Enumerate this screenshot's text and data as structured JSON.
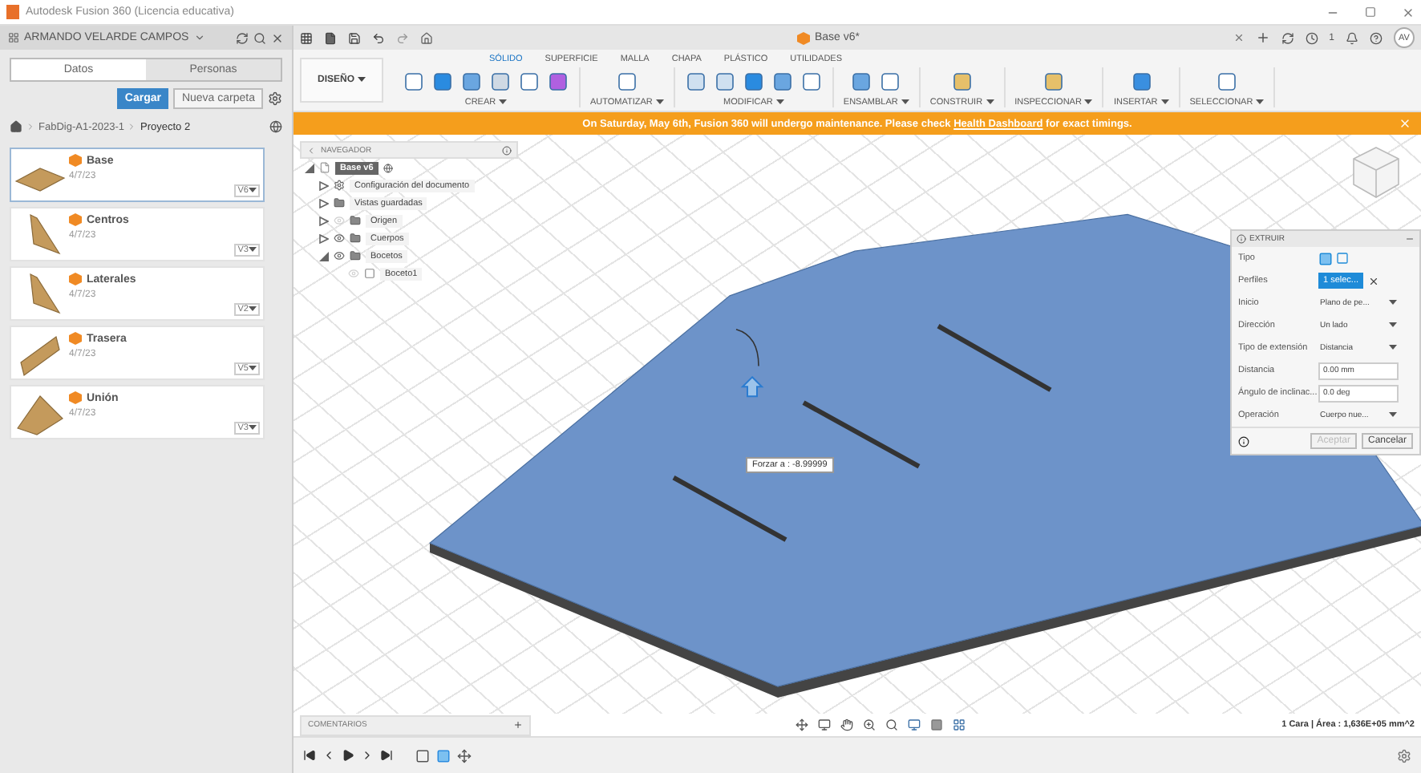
{
  "window": {
    "title": "Autodesk Fusion 360 (Licencia educativa)"
  },
  "data_panel": {
    "user": "ARMANDO VELARDE CAMPOS",
    "tabs": [
      {
        "label": "Datos",
        "selected": true
      },
      {
        "label": "Personas",
        "selected": false
      }
    ],
    "upload_button": "Cargar",
    "new_folder_button": "Nueva carpeta",
    "breadcrumb": [
      "FabDig-A1-2023-1",
      "Proyecto 2"
    ],
    "files": [
      {
        "name": "Base",
        "date": "4/7/23",
        "version": "V6",
        "selected": true,
        "kind": "plate"
      },
      {
        "name": "Centros",
        "date": "4/7/23",
        "version": "V3",
        "selected": false,
        "kind": "triangle"
      },
      {
        "name": "Laterales",
        "date": "4/7/23",
        "version": "V2",
        "selected": false,
        "kind": "triangle"
      },
      {
        "name": "Trasera",
        "date": "4/7/23",
        "version": "V5",
        "selected": false,
        "kind": "panel"
      },
      {
        "name": "Unión",
        "date": "4/7/23",
        "version": "V3",
        "selected": false,
        "kind": "wedge"
      }
    ]
  },
  "document_tab": {
    "title": "Base v6*"
  },
  "account": {
    "job_count": "1",
    "initials": "AV"
  },
  "ribbon": {
    "workspace": "DISEÑO",
    "tabs": [
      {
        "label": "SÓLIDO",
        "selected": true
      },
      {
        "label": "SUPERFICIE",
        "selected": false
      },
      {
        "label": "MALLA",
        "selected": false
      },
      {
        "label": "CHAPA",
        "selected": false
      },
      {
        "label": "PLÁSTICO",
        "selected": false
      },
      {
        "label": "UTILIDADES",
        "selected": false
      }
    ],
    "groups": [
      "CREAR",
      "AUTOMATIZAR",
      "MODIFICAR",
      "ENSAMBLAR",
      "CONSTRUIR",
      "INSPECCIONAR",
      "INSERTAR",
      "SELECCIONAR"
    ]
  },
  "banner": {
    "text": "On Saturday, May 6th, Fusion 360 will undergo maintenance. Please check ",
    "link": "Health Dashboard",
    "text_end": " for exact timings."
  },
  "browser": {
    "title": "NAVEGADOR",
    "tree": [
      {
        "label": "Base v6",
        "kind": "document",
        "selected": true,
        "expanded": true,
        "children": [
          {
            "label": "Configuración del documento",
            "kind": "settings",
            "selected": false,
            "expanded": false
          },
          {
            "label": "Vistas guardadas",
            "kind": "folder",
            "selected": false,
            "expanded": false
          },
          {
            "label": "Origen",
            "kind": "folder",
            "selected": false,
            "expanded": false,
            "visible": false
          },
          {
            "label": "Cuerpos",
            "kind": "folder",
            "selected": false,
            "expanded": false,
            "visible": true
          },
          {
            "label": "Bocetos",
            "kind": "folder",
            "selected": false,
            "expanded": true,
            "visible": true,
            "children": [
              {
                "label": "Boceto1",
                "kind": "sketch",
                "selected": false,
                "visible": false
              }
            ]
          }
        ]
      }
    ]
  },
  "viewport": {
    "force_label": "Forzar a : -8.99999",
    "status": "1 Cara | Área : 1,636E+05 mm^2"
  },
  "extrude": {
    "title": "EXTRUIR",
    "rows": [
      {
        "label": "Tipo",
        "kind": "type"
      },
      {
        "label": "Perfiles",
        "kind": "selection",
        "value": "1 selec..."
      },
      {
        "label": "Inicio",
        "kind": "dropdown",
        "value": "Plano de pe..."
      },
      {
        "label": "Dirección",
        "kind": "dropdown",
        "value": "Un lado"
      },
      {
        "label": "Tipo de extensión",
        "kind": "dropdown",
        "value": "Distancia"
      },
      {
        "label": "Distancia",
        "kind": "input",
        "value": "0.00 mm"
      },
      {
        "label": "Ángulo de inclinac...",
        "kind": "input",
        "value": "0.0 deg"
      },
      {
        "label": "Operación",
        "kind": "dropdown",
        "value": "Cuerpo nue..."
      }
    ],
    "buttons": [
      {
        "label": "Aceptar",
        "disabled": true
      },
      {
        "label": "Cancelar",
        "disabled": false
      }
    ]
  },
  "comments": {
    "title": "COMENTARIOS"
  }
}
